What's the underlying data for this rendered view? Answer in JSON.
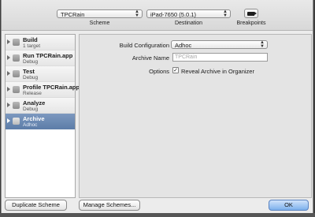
{
  "toolbar": {
    "scheme_value": "TPCRain",
    "scheme_label": "Scheme",
    "destination_value": "iPad-7650 (5.0.1)",
    "destination_label": "Destination",
    "breakpoints_label": "Breakpoints"
  },
  "actions": [
    {
      "name": "Build",
      "subtitle": "1 target"
    },
    {
      "name": "Run TPCRain.app",
      "subtitle": "Debug"
    },
    {
      "name": "Test",
      "subtitle": "Debug"
    },
    {
      "name": "Profile TPCRain.app",
      "subtitle": "Release"
    },
    {
      "name": "Analyze",
      "subtitle": "Debug"
    },
    {
      "name": "Archive",
      "subtitle": "Adhoc"
    }
  ],
  "detail": {
    "build_configuration_label": "Build Configuration",
    "build_configuration_value": "Adhoc",
    "archive_name_label": "Archive Name",
    "archive_name_placeholder": "TPCRain",
    "options_label": "Options",
    "reveal_archive_label": "Reveal Archive in Organizer",
    "reveal_archive_checked": true,
    "checkmark": "✓"
  },
  "buttons": {
    "duplicate": "Duplicate Scheme",
    "manage": "Manage Schemes...",
    "ok": "OK"
  },
  "colors": {
    "selection": "#6a88b3",
    "ok_button": "#7bb0ec"
  }
}
